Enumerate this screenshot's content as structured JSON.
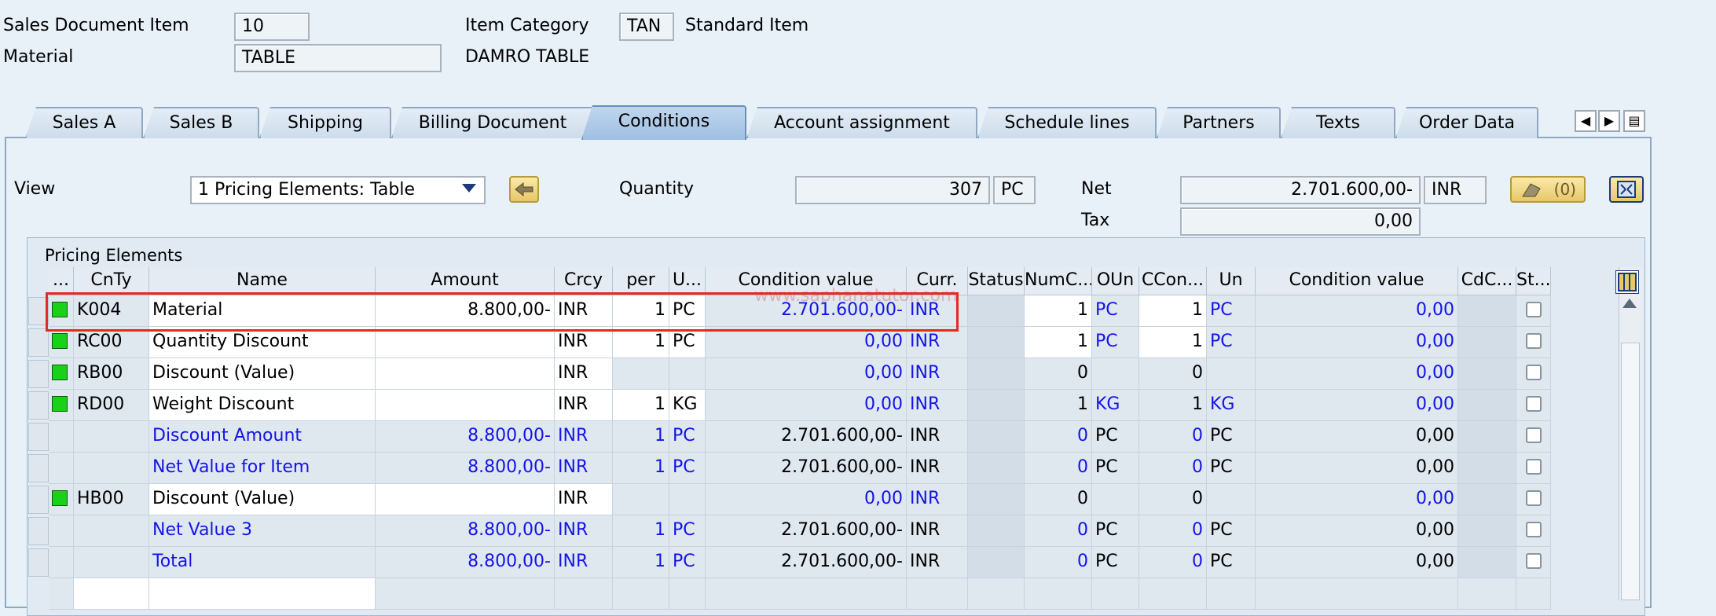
{
  "header": {
    "sales_doc_item_label": "Sales Document Item",
    "sales_doc_item_value": "10",
    "item_category_label": "Item Category",
    "item_category_value": "TAN",
    "item_category_text": "Standard Item",
    "material_label": "Material",
    "material_value": "TABLE",
    "material_text": "DAMRO TABLE"
  },
  "tabs": [
    {
      "label": "Sales A"
    },
    {
      "label": "Sales B"
    },
    {
      "label": "Shipping"
    },
    {
      "label": "Billing Document"
    },
    {
      "label": "Conditions",
      "active": true
    },
    {
      "label": "Account assignment"
    },
    {
      "label": "Schedule lines"
    },
    {
      "label": "Partners"
    },
    {
      "label": "Texts"
    },
    {
      "label": "Order Data"
    }
  ],
  "nav": {
    "prev": "◀",
    "next": "▶",
    "list": "▤"
  },
  "conditions": {
    "view_label": "View",
    "view_value": "1        Pricing Elements: Table",
    "quantity_label": "Quantity",
    "quantity_value": "307",
    "quantity_unit": "PC",
    "net_label": "Net",
    "net_value": "2.701.600,00-",
    "net_currency": "INR",
    "tax_label": "Tax",
    "tax_value": "0,00",
    "analysis_button": "(0)"
  },
  "grid": {
    "title": "Pricing Elements",
    "columns": [
      "...",
      "CnTy",
      "Name",
      "Amount",
      "Crcy",
      "per",
      "U...",
      "Condition value",
      "Curr.",
      "Status",
      "NumC...",
      "OUn",
      "CCon...",
      "Un",
      "Condition value",
      "CdC...",
      "St..."
    ],
    "watermark": "www.saphanatutor.com",
    "rows": [
      {
        "led": true,
        "cnty": "K004",
        "name": "Material",
        "amount": "8.800,00-",
        "crcy": "INR",
        "per": "1",
        "u": "PC",
        "cval": "2.701.600,00-",
        "curr": "INR",
        "numc": "1",
        "oun": "PC",
        "ccon": "1",
        "un": "PC",
        "cval2": "0,00",
        "sub": false,
        "editable": true
      },
      {
        "led": true,
        "cnty": "RC00",
        "name": "Quantity Discount",
        "amount": "",
        "crcy": "INR",
        "per": "1",
        "u": "PC",
        "cval": "0,00",
        "curr": "INR",
        "numc": "1",
        "oun": "PC",
        "ccon": "1",
        "un": "PC",
        "cval2": "0,00",
        "sub": false,
        "editable": true
      },
      {
        "led": true,
        "cnty": "RB00",
        "name": "Discount (Value)",
        "amount": "",
        "crcy": "INR",
        "per": "",
        "u": "",
        "cval": "0,00",
        "curr": "INR",
        "numc": "0",
        "oun": "",
        "ccon": "0",
        "un": "",
        "cval2": "0,00",
        "sub": false,
        "editable": false
      },
      {
        "led": true,
        "cnty": "RD00",
        "name": "Weight Discount",
        "amount": "",
        "crcy": "INR",
        "per": "1",
        "u": "KG",
        "cval": "0,00",
        "curr": "INR",
        "numc": "1",
        "oun": "KG",
        "ccon": "1",
        "un": "KG",
        "cval2": "0,00",
        "sub": false,
        "editable": false
      },
      {
        "led": false,
        "cnty": "",
        "name": "Discount Amount",
        "amount": "8.800,00-",
        "crcy": "INR",
        "per": "1",
        "u": "PC",
        "cval": "2.701.600,00-",
        "curr": "INR",
        "numc": "0",
        "oun": "PC",
        "ccon": "0",
        "un": "PC",
        "cval2": "0,00",
        "sub": true
      },
      {
        "led": false,
        "cnty": "",
        "name": "Net Value for Item",
        "amount": "8.800,00-",
        "crcy": "INR",
        "per": "1",
        "u": "PC",
        "cval": "2.701.600,00-",
        "curr": "INR",
        "numc": "0",
        "oun": "PC",
        "ccon": "0",
        "un": "PC",
        "cval2": "0,00",
        "sub": true
      },
      {
        "led": true,
        "cnty": "HB00",
        "name": "Discount (Value)",
        "amount": "",
        "crcy": "INR",
        "per": "",
        "u": "",
        "cval": "0,00",
        "curr": "INR",
        "numc": "0",
        "oun": "",
        "ccon": "0",
        "un": "",
        "cval2": "0,00",
        "sub": false,
        "editable": false
      },
      {
        "led": false,
        "cnty": "",
        "name": "Net Value 3",
        "amount": "8.800,00-",
        "crcy": "INR",
        "per": "1",
        "u": "PC",
        "cval": "2.701.600,00-",
        "curr": "INR",
        "numc": "0",
        "oun": "PC",
        "ccon": "0",
        "un": "PC",
        "cval2": "0,00",
        "sub": true
      },
      {
        "led": false,
        "cnty": "",
        "name": "Total",
        "amount": "8.800,00-",
        "crcy": "INR",
        "per": "1",
        "u": "PC",
        "cval": "2.701.600,00-",
        "curr": "INR",
        "numc": "0",
        "oun": "PC",
        "ccon": "0",
        "un": "PC",
        "cval2": "0,00",
        "sub": true
      }
    ]
  },
  "colors": {
    "blue_text": "#1414e6",
    "highlight": "#e52a1e",
    "led": "#19d119"
  }
}
